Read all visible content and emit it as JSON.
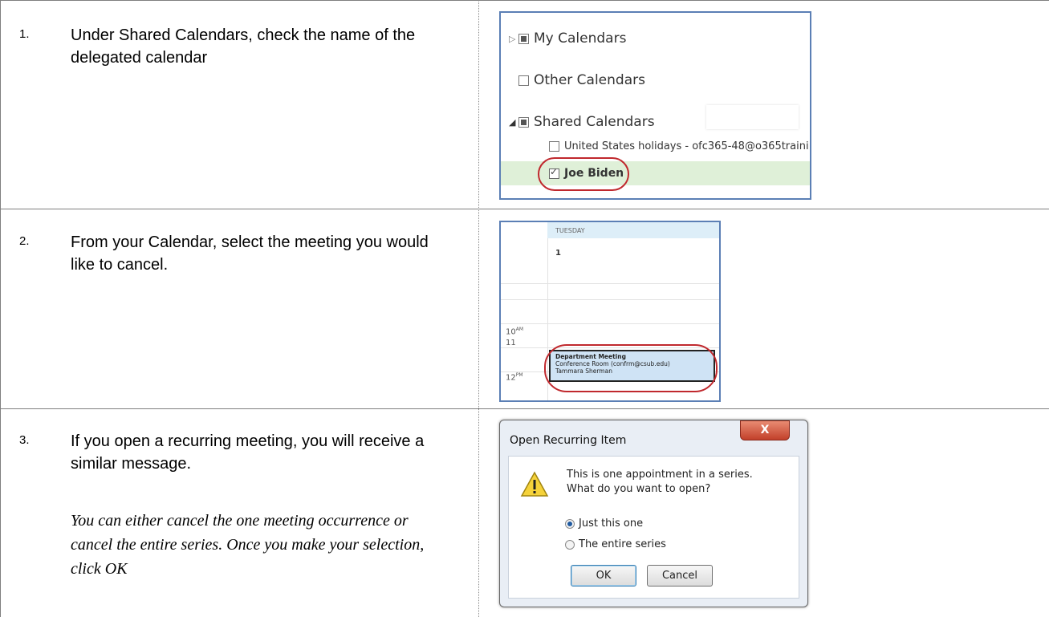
{
  "steps": [
    {
      "number": "1.",
      "text": "Under Shared Calendars, check the name of the delegated calendar",
      "screenshot": {
        "my_calendars": "My Calendars",
        "other_calendars": "Other Calendars",
        "shared_calendars": "Shared Calendars",
        "holidays": "United States holidays - ofc365-48@o365traini",
        "delegate": "Joe Biden"
      }
    },
    {
      "number": "2.",
      "text": "From your Calendar, select the meeting you would like to cancel.",
      "screenshot": {
        "day_label": "TUESDAY",
        "day_number": "1",
        "times": [
          {
            "hour": "10",
            "ampm": "AM"
          },
          {
            "hour": "11",
            "ampm": ""
          },
          {
            "hour": "12",
            "ampm": "PM"
          }
        ],
        "event": {
          "title": "Department Meeting",
          "location": "Conference Room (confrm@csub.edu)",
          "organizer": "Tammara Sherman"
        }
      }
    },
    {
      "number": "3.",
      "text": "If you open a recurring meeting, you will receive a similar message.",
      "note": "You can either cancel the one meeting occurrence or cancel the entire series.  Once you make your selection, click OK",
      "dialog": {
        "title": "Open Recurring Item",
        "close": "X",
        "message_line1": "This is one appointment in a series.",
        "message_line2": "What do you want to open?",
        "option_one": "Just this one",
        "option_two": "The entire series",
        "ok": "OK",
        "cancel": "Cancel"
      }
    }
  ]
}
